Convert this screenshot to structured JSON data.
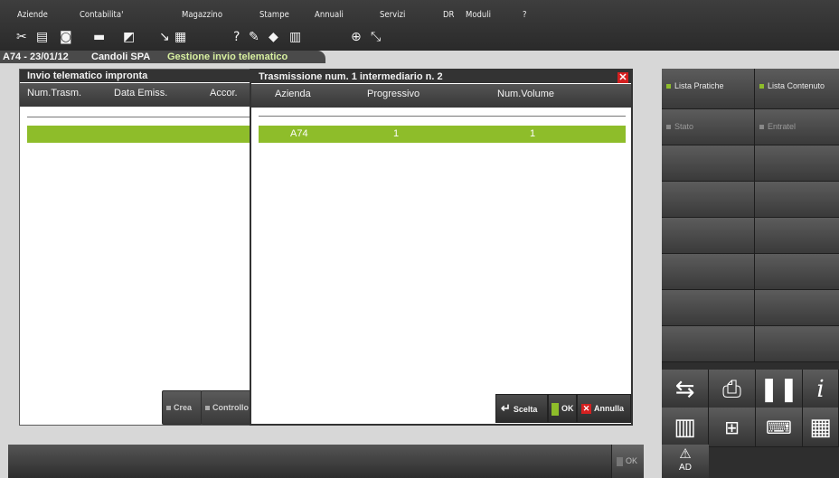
{
  "menu": [
    "Aziende",
    "Contabilita'",
    "Magazzino",
    "Stampe",
    "Annuali",
    "Servizi",
    "DR",
    "Moduli",
    "?"
  ],
  "toolbar_icons": [
    "scissors-icon",
    "document-icon",
    "save-icon",
    "print-icon",
    "import-icon",
    "table-icon",
    "help-icon",
    "edit-icon",
    "car-icon",
    "calculator-icon",
    "zoom-icon",
    "fullscreen-icon"
  ],
  "breadcrumb": {
    "company": "A74 - 23/01/12",
    "name": "Candoli SPA",
    "module": "Gestione invio telematico"
  },
  "left_panel": {
    "title": "Invio telematico impronta",
    "columns": [
      "Num.Trasm.",
      "Data Emiss.",
      "Accor."
    ],
    "buttons": [
      "Crea",
      "Controllo"
    ]
  },
  "dialog": {
    "title": "Trasmissione num.  1 intermediario n.  2",
    "columns": [
      "Azienda",
      "Progressivo",
      "Num.Volume"
    ],
    "rows": [
      {
        "azienda": "A74",
        "progressivo": "1",
        "volume": "1"
      }
    ],
    "buttons": {
      "scelta": "Scelta",
      "ok": "OK",
      "annulla": "Annulla"
    }
  },
  "right_panel": {
    "buttons": [
      "Lista Pratiche",
      "Lista Contenuto",
      "Stato",
      "Entratel"
    ]
  },
  "bottom": {
    "ok": "OK",
    "ad": "AD"
  },
  "colors": {
    "accent_green": "#8ebd2a",
    "close_red": "#d42020",
    "dark": "#333333"
  }
}
